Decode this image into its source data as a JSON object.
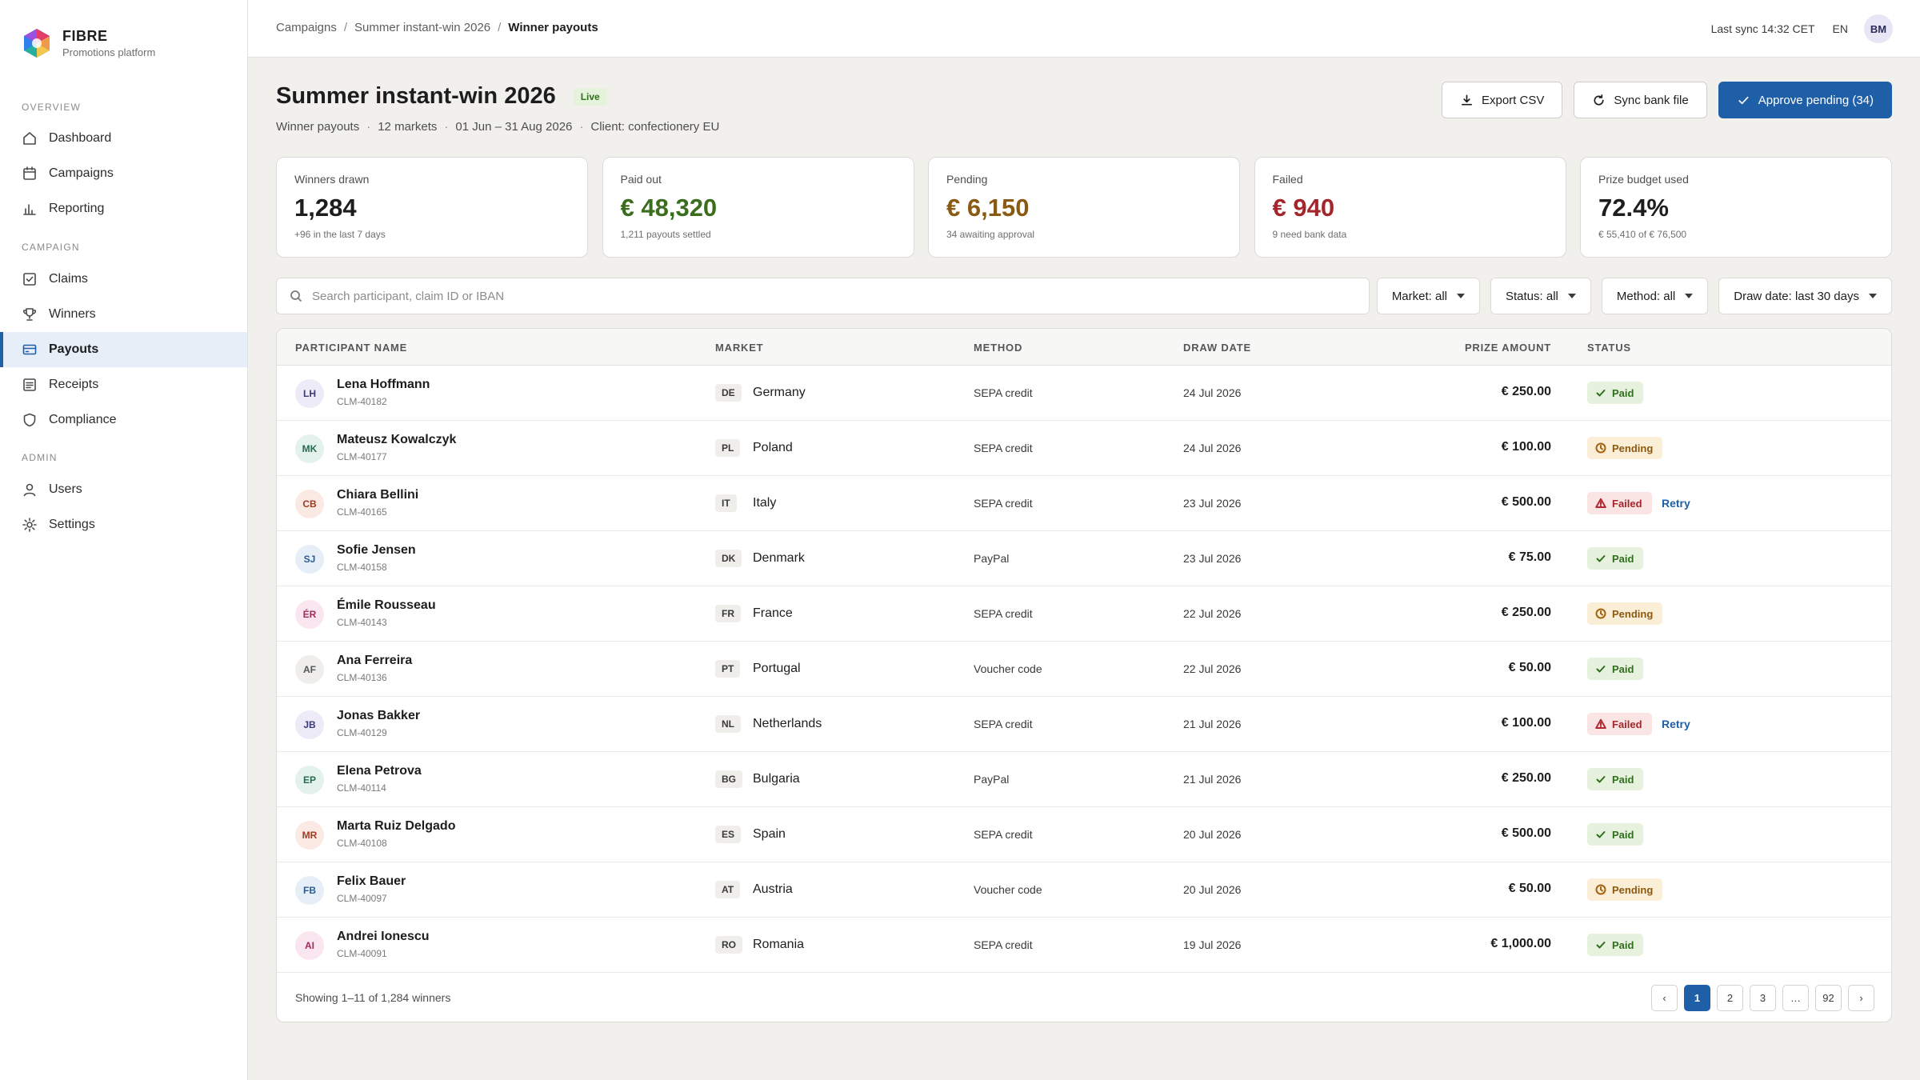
{
  "brand": {
    "name": "FIBRE",
    "subtitle": "Promotions platform"
  },
  "sidebar": {
    "sections": [
      {
        "title": "OVERVIEW",
        "items": [
          {
            "label": "Dashboard",
            "icon": "home-icon"
          },
          {
            "label": "Campaigns",
            "icon": "calendar-icon"
          },
          {
            "label": "Reporting",
            "icon": "bar-chart-icon"
          }
        ]
      },
      {
        "title": "CAMPAIGN",
        "items": [
          {
            "label": "Claims",
            "icon": "checkbox-icon"
          },
          {
            "label": "Winners",
            "icon": "trophy-icon"
          },
          {
            "label": "Payouts",
            "icon": "credit-card-icon",
            "active": true
          },
          {
            "label": "Receipts",
            "icon": "receipt-icon"
          },
          {
            "label": "Compliance",
            "icon": "shield-icon"
          }
        ]
      },
      {
        "title": "ADMIN",
        "items": [
          {
            "label": "Users",
            "icon": "user-icon"
          },
          {
            "label": "Settings",
            "icon": "gear-icon"
          }
        ]
      }
    ]
  },
  "topbar": {
    "breadcrumbs": [
      "Campaigns",
      "Summer instant-win 2026",
      "Winner payouts"
    ],
    "last_sync": "Last sync 14:32 CET",
    "language": "EN",
    "user_initials": "BM"
  },
  "header": {
    "title": "Summer instant-win 2026",
    "badge": "Live",
    "meta": [
      "Winner payouts",
      "12 markets",
      "01 Jun – 31 Aug 2026",
      "Client: confectionery EU"
    ],
    "actions": {
      "export": "Export CSV",
      "sync": "Sync bank file",
      "approve": "Approve pending (34)"
    }
  },
  "kpis": [
    {
      "label": "Winners drawn",
      "value": "1,284",
      "note": "+96 in the last 7 days",
      "tone": ""
    },
    {
      "label": "Paid out",
      "value": "€ 48,320",
      "note": "1,211 payouts settled",
      "tone": "green"
    },
    {
      "label": "Pending",
      "value": "€ 6,150",
      "note": "34 awaiting approval",
      "tone": "amber"
    },
    {
      "label": "Failed",
      "value": "€ 940",
      "note": "9 need bank data",
      "tone": "red"
    },
    {
      "label": "Prize budget used",
      "value": "72.4%",
      "note": "€ 55,410 of € 76,500",
      "tone": ""
    }
  ],
  "search": {
    "placeholder": "Search participant, claim ID or IBAN",
    "value": ""
  },
  "filters": [
    "Market: all",
    "Status: all",
    "Method: all",
    "Draw date: last 30 days"
  ],
  "table": {
    "columns": [
      "PARTICIPANT NAME",
      "MARKET",
      "METHOD",
      "DRAW DATE",
      "PRIZE AMOUNT",
      "STATUS"
    ],
    "rows": [
      {
        "initials": "LH",
        "name": "Lena Hoffmann",
        "claim": "CLM-40182",
        "code": "DE",
        "market": "Germany",
        "method": "SEPA credit",
        "date": "24 Jul 2026",
        "amount": "€ 250.00",
        "status": "Paid"
      },
      {
        "initials": "MK",
        "name": "Mateusz Kowalczyk",
        "claim": "CLM-40177",
        "code": "PL",
        "market": "Poland",
        "method": "SEPA credit",
        "date": "24 Jul 2026",
        "amount": "€ 100.00",
        "status": "Pending"
      },
      {
        "initials": "CB",
        "name": "Chiara Bellini",
        "claim": "CLM-40165",
        "code": "IT",
        "market": "Italy",
        "method": "SEPA credit",
        "date": "23 Jul 2026",
        "amount": "€ 500.00",
        "status": "Failed",
        "retry": "Retry"
      },
      {
        "initials": "SJ",
        "name": "Sofie Jensen",
        "claim": "CLM-40158",
        "code": "DK",
        "market": "Denmark",
        "method": "PayPal",
        "date": "23 Jul 2026",
        "amount": "€ 75.00",
        "status": "Paid"
      },
      {
        "initials": "ÉR",
        "name": "Émile Rousseau",
        "claim": "CLM-40143",
        "code": "FR",
        "market": "France",
        "method": "SEPA credit",
        "date": "22 Jul 2026",
        "amount": "€ 250.00",
        "status": "Pending"
      },
      {
        "initials": "AF",
        "name": "Ana Ferreira",
        "claim": "CLM-40136",
        "code": "PT",
        "market": "Portugal",
        "method": "Voucher code",
        "date": "22 Jul 2026",
        "amount": "€ 50.00",
        "status": "Paid"
      },
      {
        "initials": "JB",
        "name": "Jonas Bakker",
        "claim": "CLM-40129",
        "code": "NL",
        "market": "Netherlands",
        "method": "SEPA credit",
        "date": "21 Jul 2026",
        "amount": "€ 100.00",
        "status": "Failed",
        "retry": "Retry"
      },
      {
        "initials": "EP",
        "name": "Elena Petrova",
        "claim": "CLM-40114",
        "code": "BG",
        "market": "Bulgaria",
        "method": "PayPal",
        "date": "21 Jul 2026",
        "amount": "€ 250.00",
        "status": "Paid"
      },
      {
        "initials": "MR",
        "name": "Marta Ruiz Delgado",
        "claim": "CLM-40108",
        "code": "ES",
        "market": "Spain",
        "method": "SEPA credit",
        "date": "20 Jul 2026",
        "amount": "€ 500.00",
        "status": "Paid"
      },
      {
        "initials": "FB",
        "name": "Felix Bauer",
        "claim": "CLM-40097",
        "code": "AT",
        "market": "Austria",
        "method": "Voucher code",
        "date": "20 Jul 2026",
        "amount": "€ 50.00",
        "status": "Pending"
      },
      {
        "initials": "AI",
        "name": "Andrei Ionescu",
        "claim": "CLM-40091",
        "code": "RO",
        "market": "Romania",
        "method": "SEPA credit",
        "date": "19 Jul 2026",
        "amount": "€ 1,000.00",
        "status": "Paid"
      }
    ],
    "avatar_colors": [
      "#ecebf7",
      "#e3f2ec",
      "#fbe9e4",
      "#e6eef8",
      "#fae6ee",
      "#efeeeb",
      "#ecebf7",
      "#e3f2ec",
      "#fbe9e4",
      "#e6eef8",
      "#fae6ee"
    ],
    "avatar_text_colors": [
      "#3b3b7a",
      "#2a6b4f",
      "#a03a22",
      "#2a5c93",
      "#a02e5c",
      "#55555a",
      "#3b3b7a",
      "#2a6b4f",
      "#a03a22",
      "#2a5c93",
      "#a02e5c"
    ]
  },
  "footer": {
    "showing": "Showing 1–11 of 1,284 winners",
    "pages": [
      "‹",
      "1",
      "2",
      "3",
      "…",
      "92",
      "›"
    ],
    "current_page": "1"
  },
  "colors": {
    "accent": "#1f5fa8",
    "paid": "#2f6e1c",
    "pending": "#8a5a12",
    "failed": "#a4262c"
  }
}
